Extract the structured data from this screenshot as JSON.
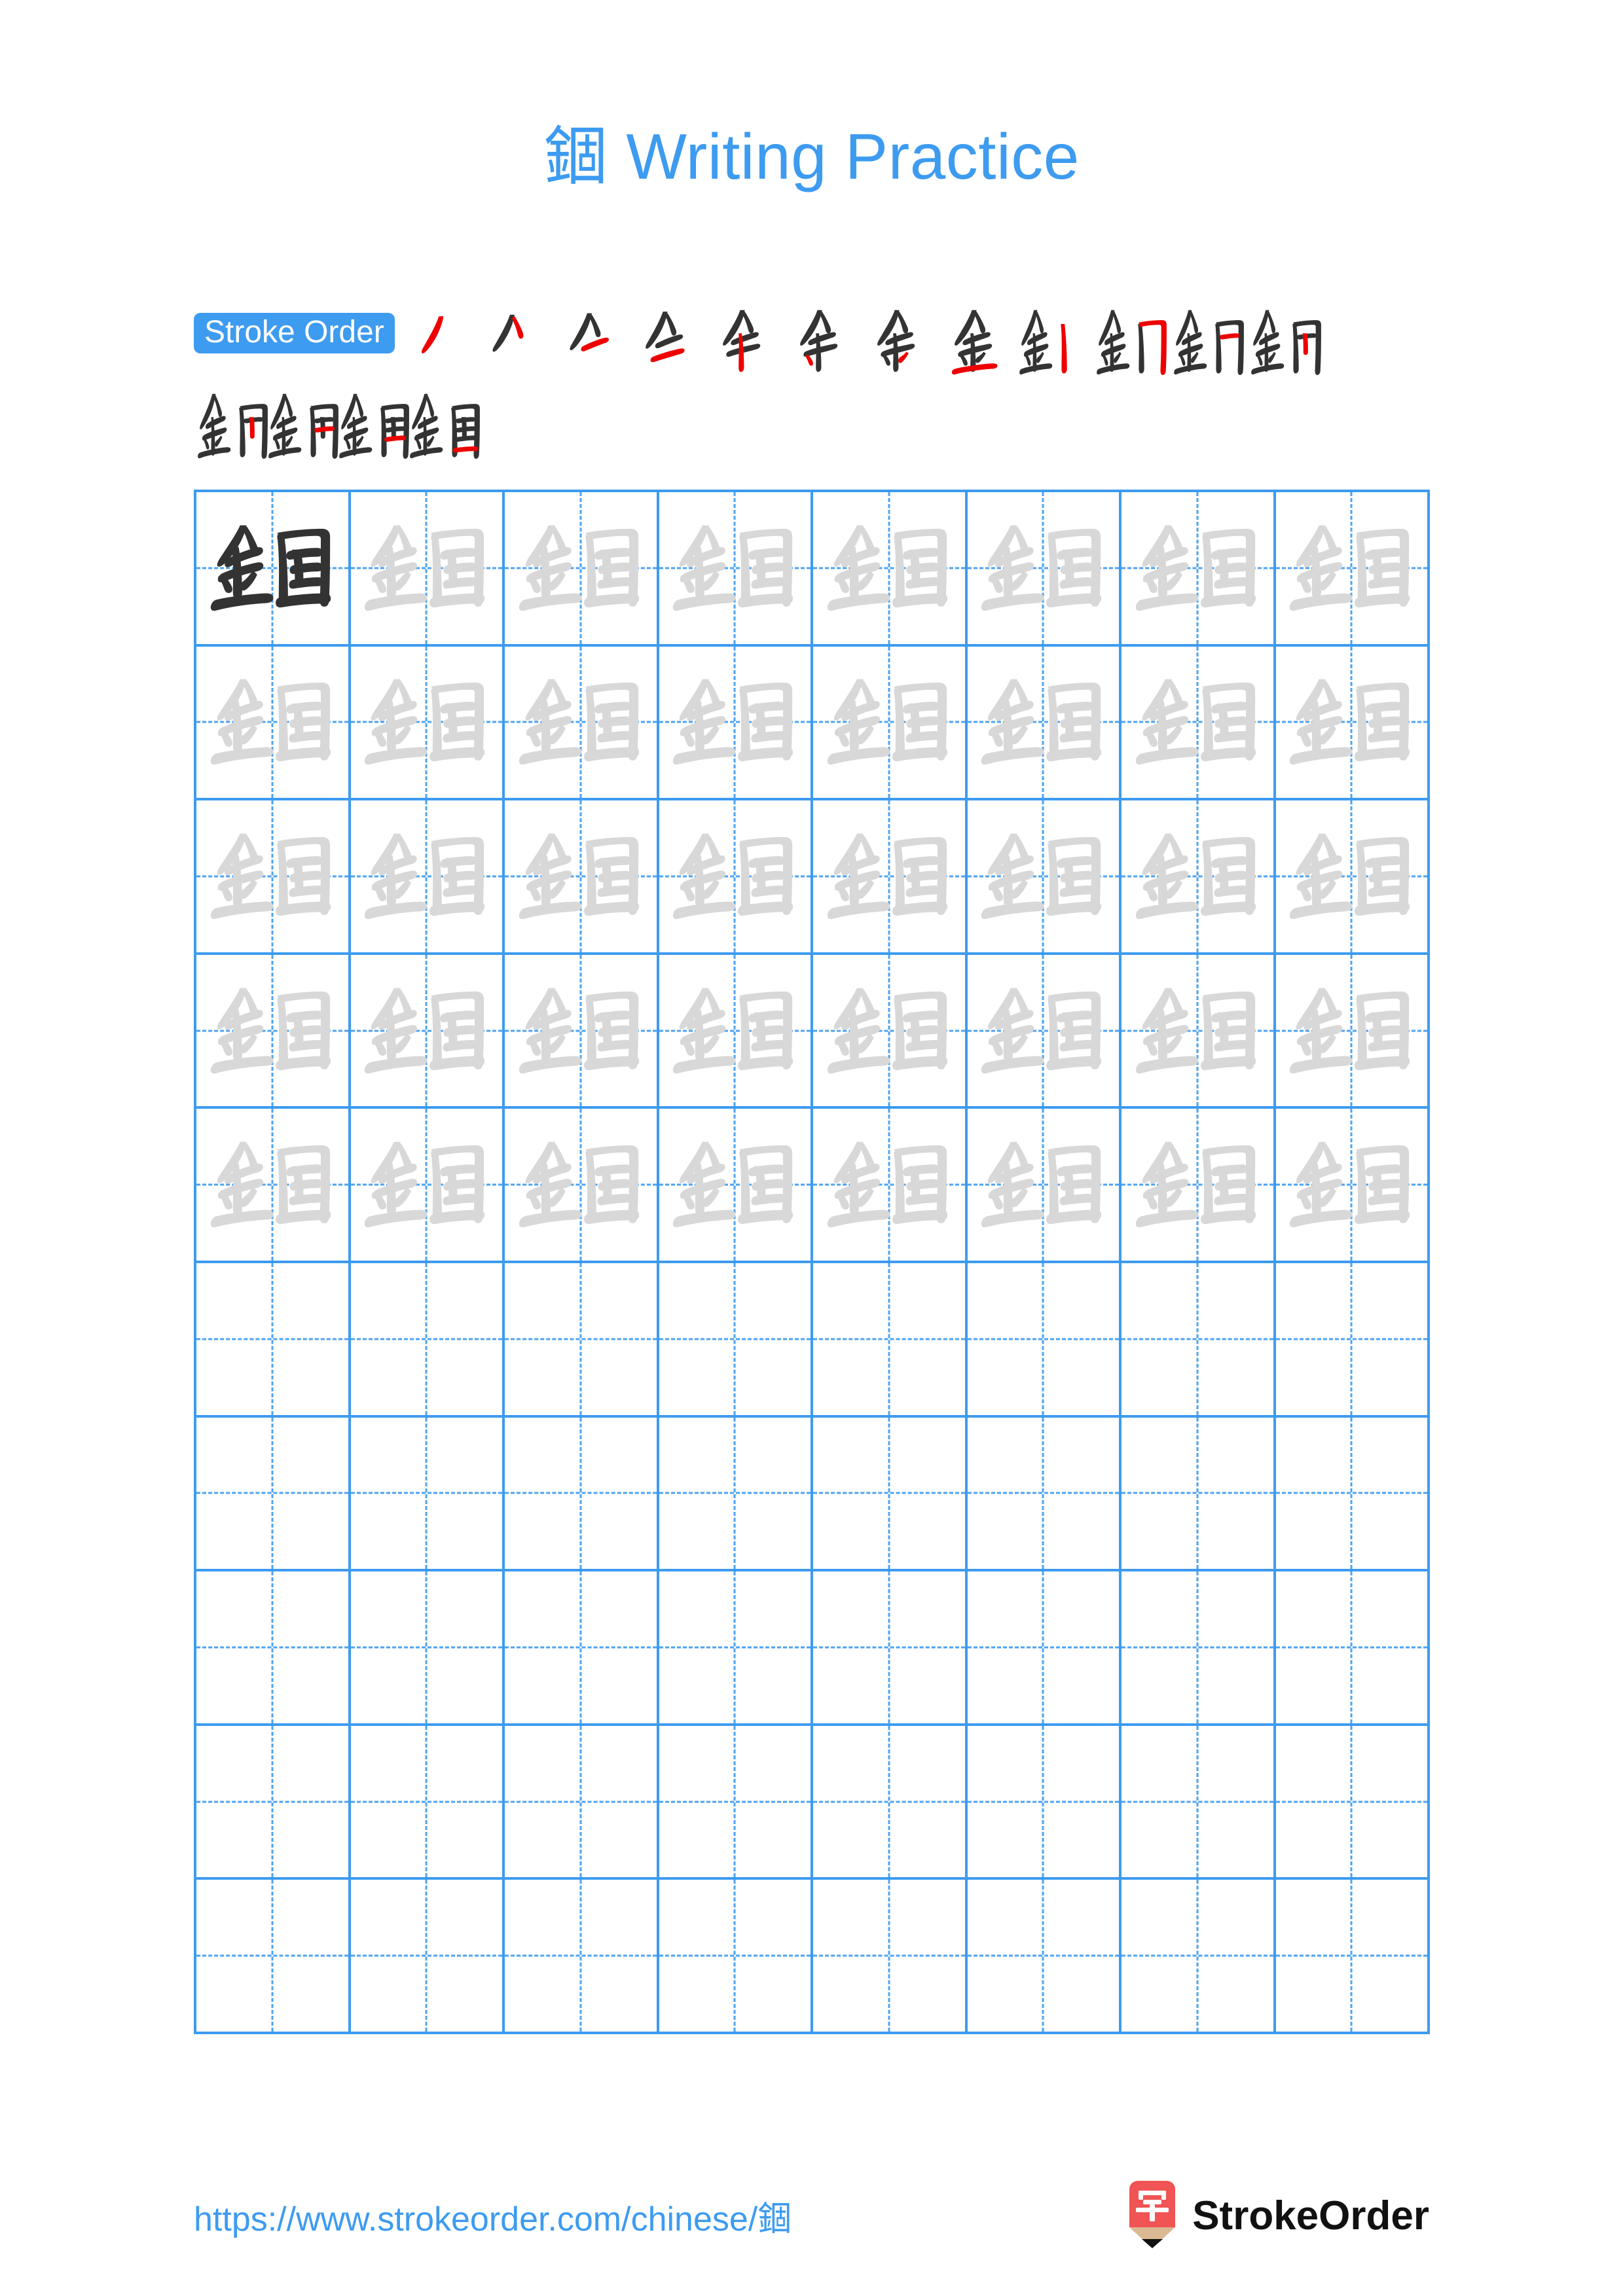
{
  "character": "錮",
  "title": {
    "character": "錮",
    "suffix": " Writing Practice",
    "full": "錮 Writing Practice",
    "color": "#3d9bf0"
  },
  "stroke_order": {
    "badge_label": "Stroke Order",
    "badge_bg": "#3d9bf0",
    "badge_text_color": "#ffffff",
    "total_strokes": 16,
    "new_stroke_color": "#ee0000",
    "existing_stroke_color": "#333333",
    "line1_count": 12,
    "line2_count": 4,
    "steps": [
      {
        "index": 1,
        "new_stroke_name": "pie"
      },
      {
        "index": 2,
        "new_stroke_name": "na"
      },
      {
        "index": 3,
        "new_stroke_name": "heng"
      },
      {
        "index": 4,
        "new_stroke_name": "heng"
      },
      {
        "index": 5,
        "new_stroke_name": "shu"
      },
      {
        "index": 6,
        "new_stroke_name": "dian-left"
      },
      {
        "index": 7,
        "new_stroke_name": "dian-right"
      },
      {
        "index": 8,
        "new_stroke_name": "heng-base"
      },
      {
        "index": 9,
        "new_stroke_name": "shu-left-enclosure"
      },
      {
        "index": 10,
        "new_stroke_name": "heng-zhe-gou"
      },
      {
        "index": 11,
        "new_stroke_name": "heng-top-inner"
      },
      {
        "index": 12,
        "new_stroke_name": "shu-inner"
      },
      {
        "index": 13,
        "new_stroke_name": "heng-zhe-inner"
      },
      {
        "index": 14,
        "new_stroke_name": "heng-mid-inner"
      },
      {
        "index": 15,
        "new_stroke_name": "heng-lower-inner"
      },
      {
        "index": 16,
        "new_stroke_name": "heng-bottom-close"
      }
    ]
  },
  "practice_grid": {
    "columns": 8,
    "rows": 10,
    "grid_line_color": "#3d9bf0",
    "guide_line_color": "#4da3f2",
    "first_cell_ink": "#333333",
    "trace_ink": "#d8d8d8",
    "filled_rows": 5,
    "empty_rows": 5,
    "cells": [
      [
        "dark",
        "trace",
        "trace",
        "trace",
        "trace",
        "trace",
        "trace",
        "trace"
      ],
      [
        "trace",
        "trace",
        "trace",
        "trace",
        "trace",
        "trace",
        "trace",
        "trace"
      ],
      [
        "trace",
        "trace",
        "trace",
        "trace",
        "trace",
        "trace",
        "trace",
        "trace"
      ],
      [
        "trace",
        "trace",
        "trace",
        "trace",
        "trace",
        "trace",
        "trace",
        "trace"
      ],
      [
        "trace",
        "trace",
        "trace",
        "trace",
        "trace",
        "trace",
        "trace",
        "trace"
      ],
      [
        "empty",
        "empty",
        "empty",
        "empty",
        "empty",
        "empty",
        "empty",
        "empty"
      ],
      [
        "empty",
        "empty",
        "empty",
        "empty",
        "empty",
        "empty",
        "empty",
        "empty"
      ],
      [
        "empty",
        "empty",
        "empty",
        "empty",
        "empty",
        "empty",
        "empty",
        "empty"
      ],
      [
        "empty",
        "empty",
        "empty",
        "empty",
        "empty",
        "empty",
        "empty",
        "empty"
      ],
      [
        "empty",
        "empty",
        "empty",
        "empty",
        "empty",
        "empty",
        "empty",
        "empty"
      ]
    ]
  },
  "footer": {
    "url": "https://www.strokeorder.com/chinese/錮",
    "url_color": "#3d9bf0",
    "brand_name": "StrokeOrder",
    "logo_character": "字",
    "logo_body_color": "#f05454",
    "logo_tip_color": "#dbb994",
    "logo_point_color": "#111111"
  }
}
